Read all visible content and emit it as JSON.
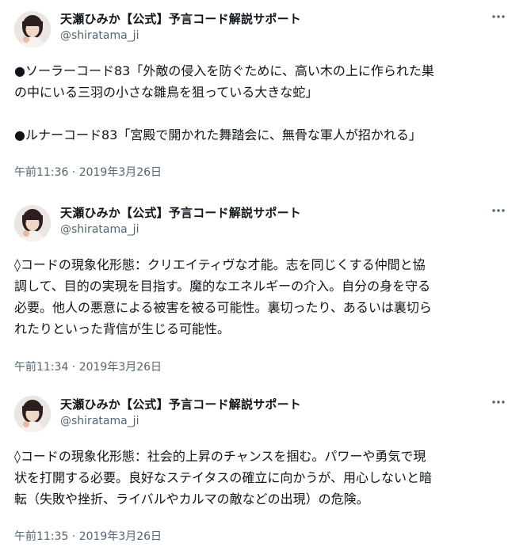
{
  "tweets": [
    {
      "author": "天瀬ひみか【公式】予言コード解説サポート",
      "handle": "@shiratama_ji",
      "lines": [
        "●ソーラーコード83「外敵の侵入を防ぐために、高い木の上に作られた巣",
        "の中にいる三羽の小さな雛鳥を狙っている大きな蛇」",
        "",
        "●ルナーコード83「宮殿で開かれた舞踏会に、無骨な軍人が招かれる」"
      ],
      "timestamp": "午前11:36 · 2019年3月26日"
    },
    {
      "author": "天瀬ひみか【公式】予言コード解説サポート",
      "handle": "@shiratama_ji",
      "lines": [
        "◊コードの現象化形態：クリエイティヴな才能。志を同じくする仲間と協",
        "調して、目的の実現を目指す。魔的なエネルギーの介入。自分の身を守る",
        "必要。他人の悪意による被害を被る可能性。裏切ったり、あるいは裏切ら",
        "れたりといった背信が生じる可能性。"
      ],
      "timestamp": "午前11:34 · 2019年3月26日"
    },
    {
      "author": "天瀬ひみか【公式】予言コード解説サポート",
      "handle": "@shiratama_ji",
      "lines": [
        "◊コードの現象化形態：社会的上昇のチャンスを掴む。パワーや勇気で現",
        "状を打開する必要。良好なステイタスの確立に向かうが、用心しないと暗",
        "転（失敗や挫折、ライバルやカルマの敵などの出現）の危険。"
      ],
      "timestamp": "午前11:35 · 2019年3月26日"
    }
  ],
  "icons": {
    "more": "more-horizontal-icon",
    "avatar": "profile-photo"
  },
  "colors": {
    "text": "#0f1419",
    "secondary": "#536471"
  }
}
